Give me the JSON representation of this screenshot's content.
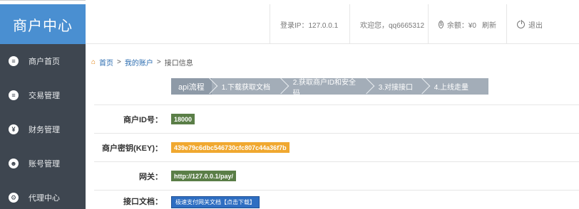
{
  "sidebar": {
    "brand": "商户中心",
    "items": [
      {
        "label": "商户首页",
        "icon": "≡"
      },
      {
        "label": "交易管理",
        "icon": "≡"
      },
      {
        "label": "财务管理",
        "icon": "¥"
      },
      {
        "label": "账号管理",
        "icon": "☻"
      },
      {
        "label": "代理中心",
        "icon": "⚙"
      }
    ]
  },
  "header": {
    "login_ip": "登录IP：127.0.0.1",
    "welcome": "欢迎您，qq6665312",
    "balance": "余额：¥0",
    "refresh": "刷新",
    "logout": "退出"
  },
  "breadcrumb": {
    "home": "首页",
    "sep1": ">",
    "account": "我的账户",
    "sep2": ">",
    "current": "接口信息"
  },
  "steps": [
    "api流程",
    "1.下载获取文档",
    "2.获取商户ID和安全码",
    "3.对接接口",
    "4.上线走量"
  ],
  "info": {
    "merchant_id_label": "商户ID号：",
    "merchant_id": "18000",
    "key_label": "商户密钥(KEY)：",
    "key": "439e79c6dbc546730cfc807c44a36f7b",
    "gateway_label": "网关：",
    "gateway": "http://127.0.0.1/pay/",
    "docs_label": "接口文档：",
    "docs_button": "极速支付网关文档【点击下载】"
  },
  "colors": {
    "sidebar_bg": "#3e4650",
    "brand_bg": "#4a8fd1",
    "green_badge": "#5a7e47",
    "orange_badge": "#f0a830",
    "doc_button": "#2e6ec2"
  }
}
